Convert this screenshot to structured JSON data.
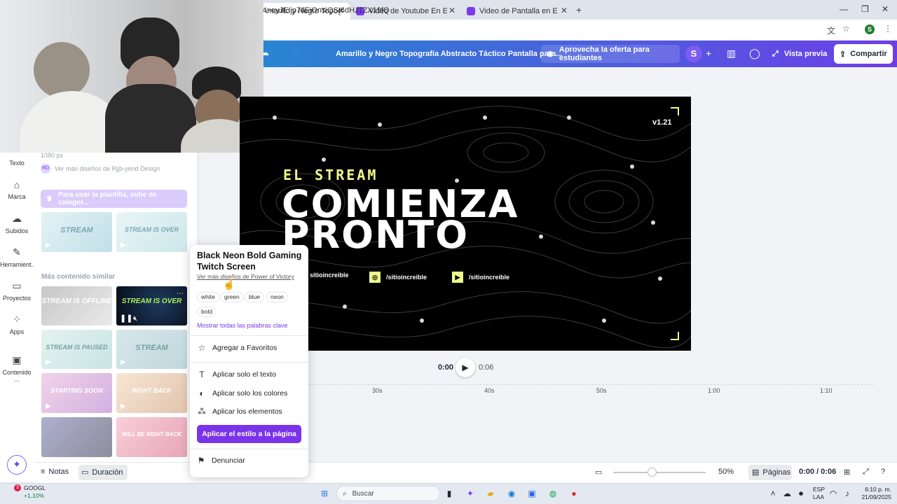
{
  "browser": {
    "tabs": [
      {
        "title": "Amarillo y Negro Topografía Ab",
        "active": true
      },
      {
        "title": "Video de Youtube En Espera En",
        "active": false
      },
      {
        "title": "Video de Pantalla en Espera pa",
        "active": false
      }
    ],
    "url": "i=eyJEIjp7IlEiOnsiQSI6dHJ1ZX19fQ",
    "profile_initial": "S"
  },
  "header": {
    "doc_title": "Amarillo y Negro Topografía Abstracto Táctico Pantalla para...",
    "offer": "Aprovecha la oferta para estudiantes",
    "avatar": "S",
    "preview": "Vista previa",
    "share": "Compartir"
  },
  "rail": [
    {
      "label": "Texto",
      "icon": "text-icon"
    },
    {
      "label": "Marca",
      "icon": "brand-icon"
    },
    {
      "label": "Subidos",
      "icon": "upload-cloud-icon"
    },
    {
      "label": "Herramient...",
      "icon": "tools-icon"
    },
    {
      "label": "Proyectos",
      "icon": "folder-icon"
    },
    {
      "label": "Apps",
      "icon": "apps-icon"
    },
    {
      "label": "Contenido ...",
      "icon": "content-icon"
    }
  ],
  "panel": {
    "size": "1080 px",
    "more_from": "Ver más diseños de Rjjb-yend Design",
    "author_badge": "RD",
    "upgrade": "Para usar la plantilla, sube de categor...",
    "similar_title": "Más contenido similar",
    "thumbs": [
      {
        "label": "STREAM"
      },
      {
        "label": "STREAM IS OVER"
      },
      {
        "label": "STREAM IS OFFLINE"
      },
      {
        "label": "STREAM IS OVER"
      },
      {
        "label": "STREAM IS PAUSED"
      },
      {
        "label": "STREAM"
      },
      {
        "label": "STARTING SOON"
      },
      {
        "label": "RIGHT BACK"
      },
      {
        "label": ""
      },
      {
        "label": "WILL BE RIGHT BACK"
      }
    ]
  },
  "design": {
    "subtitle": "EL STREAM",
    "title_line1": "COMIENZA",
    "title_line2": "PRONTO",
    "version": "v1.21",
    "social": [
      {
        "handle": "sitioincreible",
        "icon": "generic"
      },
      {
        "handle": "/sitioincreible",
        "icon": "instagram-icon"
      },
      {
        "handle": "/sitioincreible",
        "icon": "youtube-icon"
      }
    ],
    "accent": "#eef98a"
  },
  "timeline": {
    "current": "0:00",
    "total": "0:06",
    "ruler": [
      "30s",
      "40s",
      "50s",
      "1:00",
      "1:10"
    ]
  },
  "popup": {
    "title": "Black Neon Bold Gaming Twitch Screen",
    "author": "Ver más diseños de Power of Victory",
    "keywords": [
      "white",
      "green",
      "blue",
      "neon",
      "bold"
    ],
    "show_keywords": "Mostrar todas las palabras clave",
    "favorite": "Agregar a Favoritos",
    "apply_text": "Aplicar solo el texto",
    "apply_colors": "Aplicar solo los colores",
    "apply_elements": "Aplicar los elementos",
    "apply_page": "Aplicar el estilo a la página",
    "report": "Denunciar"
  },
  "bottombar": {
    "notes": "Notas",
    "duration": "Duración",
    "zoom": "50%",
    "pages": "Páginas",
    "time": "0:00 / 0:06"
  },
  "taskbar": {
    "stock_name": "GOOGL",
    "stock_change": "+1,10%",
    "badge": "3",
    "search": "Buscar",
    "lang1": "ESP",
    "lang2": "LAA",
    "clock_time": "6:10 p. m.",
    "clock_date": "21/09/2025"
  }
}
